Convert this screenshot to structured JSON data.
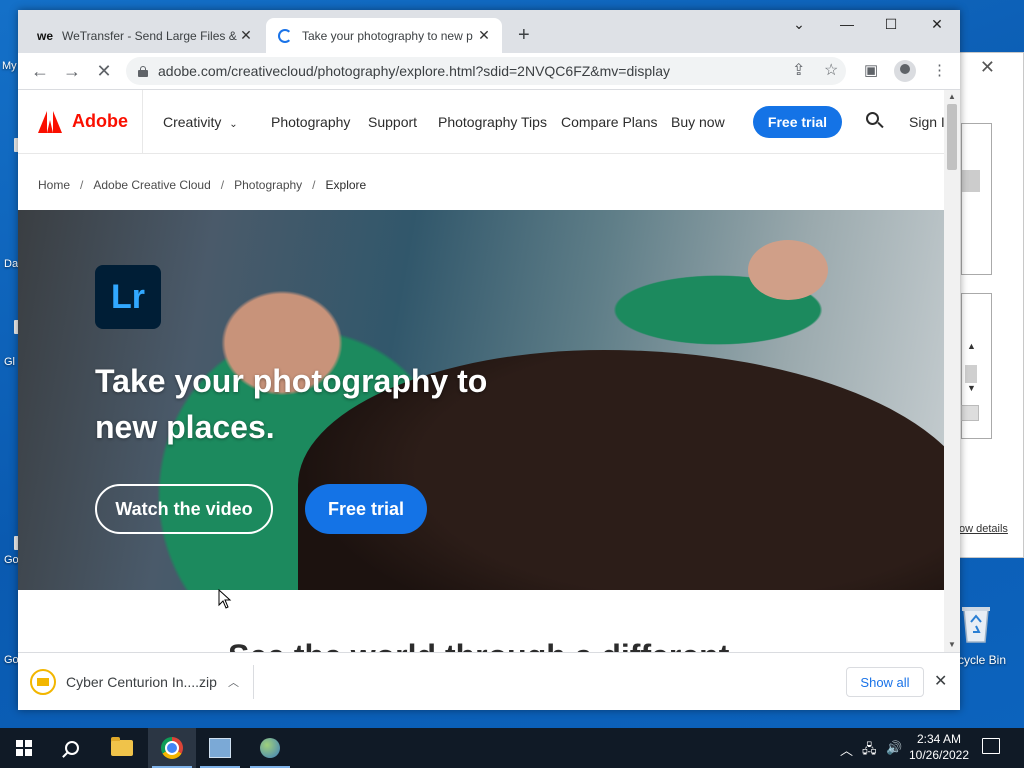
{
  "desktop": {
    "icon_labels": [
      "My",
      "Da",
      "Gl",
      "Go",
      "Go"
    ],
    "recycle_bin_label": "cycle Bin"
  },
  "background_dialog": {
    "details_link": "ow details"
  },
  "browser": {
    "tabs": [
      {
        "title": "WeTransfer - Send Large Files &",
        "favicon": "we"
      },
      {
        "title": "Take your photography to new p",
        "favicon": "loading-spinner"
      }
    ],
    "new_tab_symbol": "+",
    "window_controls": {
      "minimize": "—",
      "maximize": "☐",
      "close": "✕",
      "dropdown": "⌄"
    },
    "url": "adobe.com/creativecloud/photography/explore.html?sdid=2NVQC6FZ&mv=display"
  },
  "page": {
    "brand": "Adobe",
    "nav": {
      "creativity": "Creativity",
      "items": [
        "Photography",
        "Support",
        "Photography Tips",
        "Compare Plans",
        "Buy now"
      ],
      "free_trial": "Free trial",
      "sign_in": "Sign In"
    },
    "breadcrumb": [
      "Home",
      "Adobe Creative Cloud",
      "Photography",
      "Explore"
    ],
    "hero": {
      "badge": "Lr",
      "headline": "Take your photography to new places.",
      "watch_video": "Watch the video",
      "free_trial": "Free trial"
    },
    "section_title": "See the world through a different"
  },
  "downloads": {
    "file_name": "Cyber Centurion In....zip",
    "show_all": "Show all"
  },
  "taskbar": {
    "time": "2:34 AM",
    "date": "10/26/2022"
  },
  "colors": {
    "adobe_red": "#fa0f00",
    "adobe_blue": "#1473e6",
    "lr_bg": "#001e36",
    "lr_fg": "#31a8ff"
  }
}
